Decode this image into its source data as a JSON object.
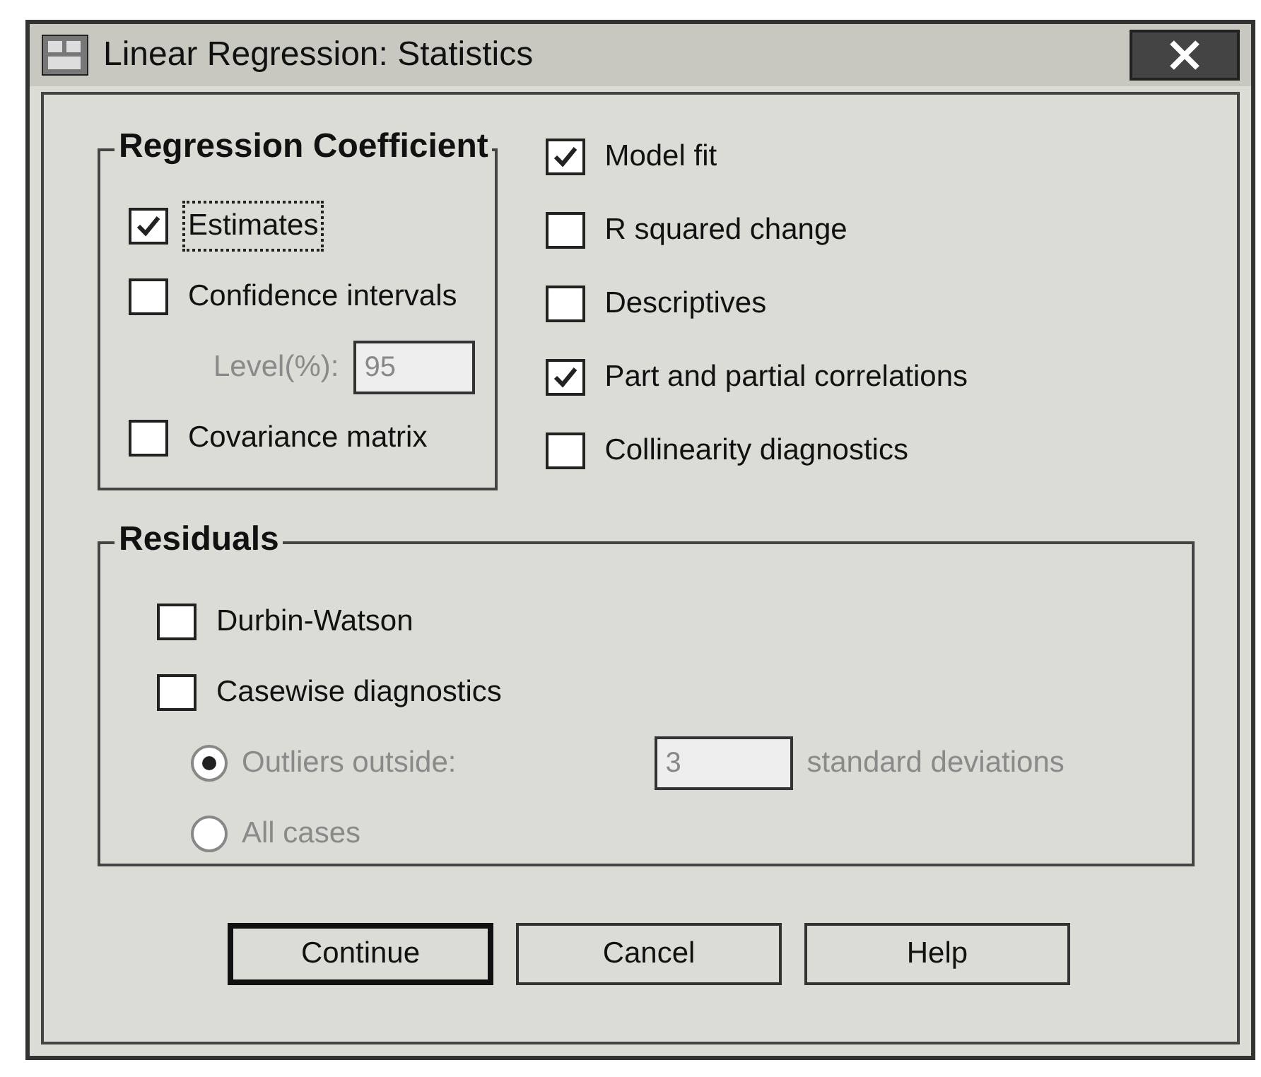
{
  "window": {
    "title": "Linear Regression: Statistics"
  },
  "regression_coefficient": {
    "title": "Regression Coefficient",
    "items": [
      {
        "kind": "checkbox",
        "label": "Estimates",
        "checked": true,
        "focused": true
      },
      {
        "kind": "checkbox",
        "label": "Confidence intervals",
        "checked": false,
        "focused": false
      },
      {
        "kind": "field",
        "label": "Level(%):",
        "value": "95",
        "disabled": true
      },
      {
        "kind": "checkbox",
        "label": "Covariance matrix",
        "checked": false,
        "focused": false
      }
    ]
  },
  "model_options": [
    {
      "label": "Model fit",
      "checked": true
    },
    {
      "label": "R squared change",
      "checked": false
    },
    {
      "label": "Descriptives",
      "checked": false
    },
    {
      "label": "Part and partial correlations",
      "checked": true
    },
    {
      "label": "Collinearity diagnostics",
      "checked": false
    }
  ],
  "residuals": {
    "title": "Residuals",
    "checks": [
      {
        "label": "Durbin-Watson",
        "checked": false
      },
      {
        "label": "Casewise diagnostics",
        "checked": false
      }
    ],
    "radios": [
      {
        "label": "Outliers outside:",
        "selected": true,
        "disabled": true
      },
      {
        "label": "All cases",
        "selected": false,
        "disabled": true
      }
    ],
    "sd_field": {
      "value": "3",
      "disabled": true
    },
    "sd_suffix": "standard deviations"
  },
  "buttons": [
    {
      "label": "Continue",
      "default": true
    },
    {
      "label": "Cancel",
      "default": false
    },
    {
      "label": "Help",
      "default": false
    }
  ]
}
